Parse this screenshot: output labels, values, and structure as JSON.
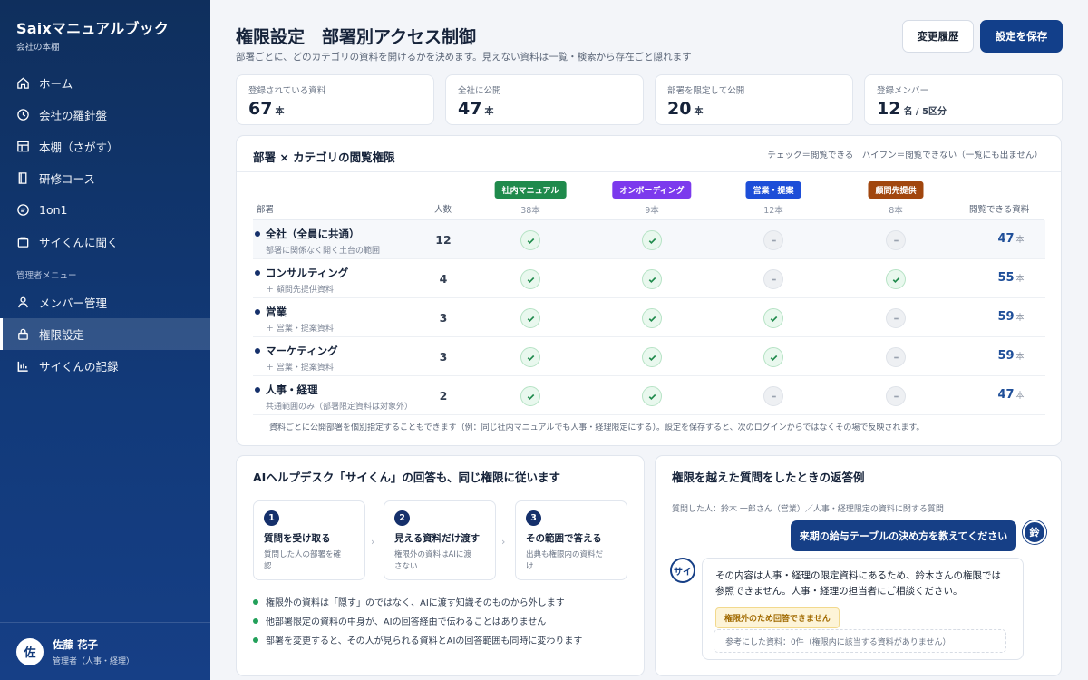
{
  "sidebar": {
    "brand": "Saixマニュアルブック",
    "brand_sub": "会社の本棚",
    "items": [
      {
        "label": "ホーム"
      },
      {
        "label": "会社の羅針盤"
      },
      {
        "label": "本棚（さがす）"
      },
      {
        "label": "研修コース"
      },
      {
        "label": "1on1"
      },
      {
        "label": "サイくんに聞く"
      }
    ],
    "admin_section": "管理者メニュー",
    "admin_items": [
      {
        "label": "メンバー管理"
      },
      {
        "label": "権限設定"
      },
      {
        "label": "サイくんの記録"
      }
    ],
    "user": {
      "initial": "佐",
      "name": "佐藤 花子",
      "role": "管理者（人事・経理）"
    }
  },
  "header": {
    "title": "権限設定　部署別アクセス制御",
    "subtitle": "部署ごとに、どのカテゴリの資料を開けるかを決めます。見えない資料は一覧・検索から存在ごと隠れます",
    "history_button": "変更履歴",
    "save_button": "設定を保存"
  },
  "stats": [
    {
      "label": "登録されている資料",
      "value": "67",
      "unit": "本"
    },
    {
      "label": "全社に公開",
      "value": "47",
      "unit": "本"
    },
    {
      "label": "部署を限定して公開",
      "value": "20",
      "unit": "本"
    },
    {
      "label": "登録メンバー",
      "value": "12",
      "unit": "名 / 5区分"
    }
  ],
  "matrix": {
    "title": "部署 × カテゴリの閲覧権限",
    "legend": "チェック＝閲覧できる　ハイフン＝閲覧できない（一覧にも出ません）",
    "col_dept": "部署",
    "col_members": "人数",
    "col_access": "閲覧できる資料",
    "categories": [
      {
        "name": "社内マニュアル",
        "count": "38本",
        "color": "#1f8a4c"
      },
      {
        "name": "オンボーディング",
        "count": "9本",
        "color": "#7c3aed"
      },
      {
        "name": "営業・提案",
        "count": "12本",
        "color": "#1d4ed8"
      },
      {
        "name": "顧問先提供",
        "count": "8本",
        "color": "#a1460e"
      }
    ],
    "access_unit": "本",
    "rows": [
      {
        "name": "全社（全員に共通）",
        "sub": "部署に関係なく開く土台の範囲",
        "members": "12",
        "perms": [
          true,
          true,
          false,
          false
        ],
        "access": "47"
      },
      {
        "name": "コンサルティング",
        "sub": "＋ 顧問先提供資料",
        "members": "4",
        "perms": [
          true,
          true,
          false,
          true
        ],
        "access": "55"
      },
      {
        "name": "営業",
        "sub": "＋ 営業・提案資料",
        "members": "3",
        "perms": [
          true,
          true,
          true,
          false
        ],
        "access": "59"
      },
      {
        "name": "マーケティング",
        "sub": "＋ 営業・提案資料",
        "members": "3",
        "perms": [
          true,
          true,
          true,
          false
        ],
        "access": "59"
      },
      {
        "name": "人事・経理",
        "sub": "共通範囲のみ（部署限定資料は対象外）",
        "members": "2",
        "perms": [
          true,
          true,
          false,
          false
        ],
        "access": "47"
      }
    ],
    "footnote": "資料ごとに公開部署を個別指定することもできます（例：同じ社内マニュアルでも人事・経理限定にする）。設定を保存すると、次のログインからではなくその場で反映されます。"
  },
  "ai_card": {
    "title": "AIヘルプデスク「サイくん」の回答も、同じ権限に従います",
    "steps": [
      {
        "num": "1",
        "title": "質問を受け取る",
        "desc1": "質問した人の部署を確",
        "desc2": "認"
      },
      {
        "num": "2",
        "title": "見える資料だけ渡す",
        "desc1": "権限外の資料はAIに渡",
        "desc2": "さない"
      },
      {
        "num": "3",
        "title": "その範囲で答える",
        "desc1": "出典も権限内の資料だ",
        "desc2": "け"
      }
    ],
    "chevron": "›",
    "bullets": [
      "権限外の資料は「隠す」のではなく、AIに渡す知識そのものから外します",
      "他部署限定の資料の中身が、AIの回答経由で伝わることはありません",
      "部署を変更すると、その人が見られる資料とAIの回答範囲も同時に変わります"
    ]
  },
  "example_card": {
    "title": "権限を越えた質問をしたときの返答例",
    "meta": "質問した人：鈴木 一郎さん（営業）／人事・経理限定の資料に関する質問",
    "user_initial": "鈴",
    "question": "来期の給与テーブルの決め方を教えてください",
    "ai_initial": "サイ",
    "answer_line1": "その内容は人事・経理の限定資料にあるため、鈴木さんの権限では",
    "answer_line2": "参照できません。人事・経理の担当者にご相談ください。",
    "badge": "権限外のため回答できません",
    "reference": "参考にした資料：0件（権限内に該当する資料がありません）"
  }
}
